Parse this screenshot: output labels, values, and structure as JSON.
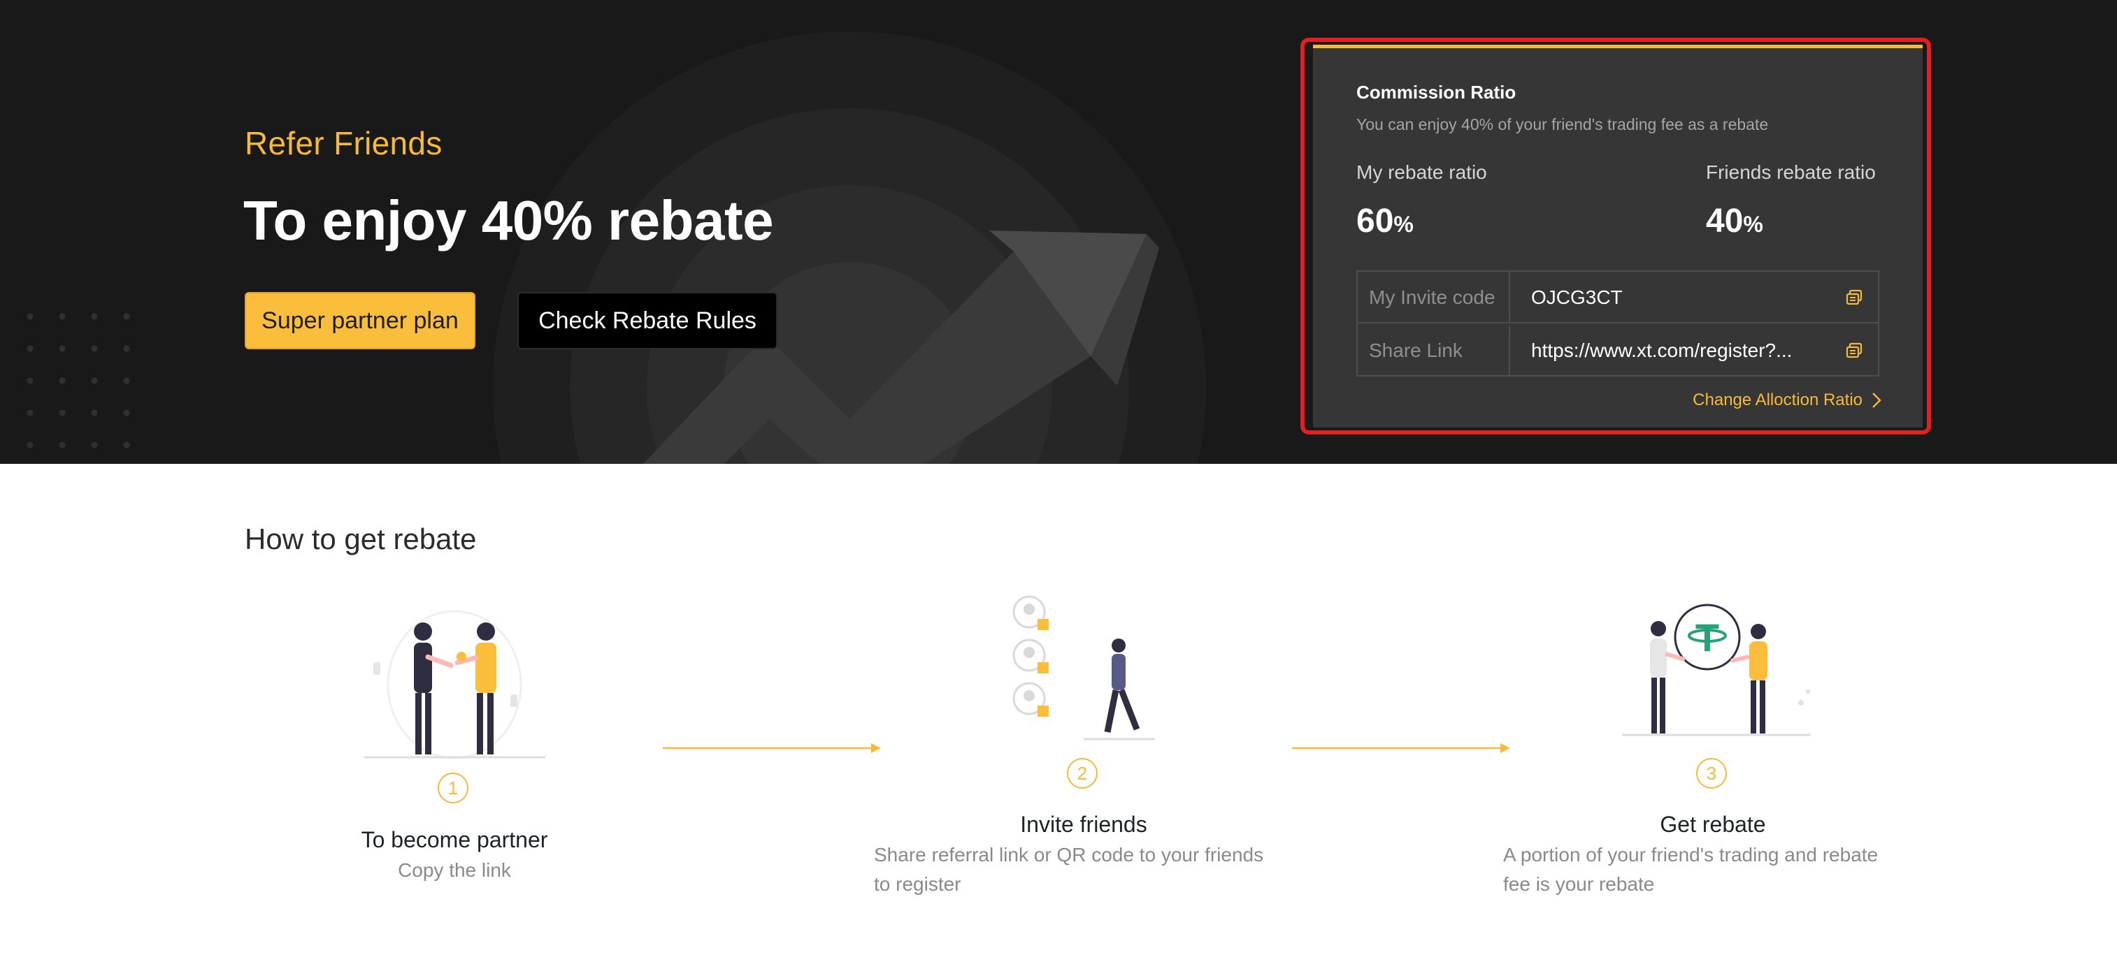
{
  "hero": {
    "refer_title": "Refer Friends",
    "headline": "To enjoy 40% rebate",
    "partner_button": "Super partner plan",
    "rules_button": "Check Rebate Rules"
  },
  "commission": {
    "title": "Commission Ratio",
    "subtitle": "You can enjoy 40% of your friend's trading fee as a rebate",
    "my_ratio_label": "My rebate ratio",
    "my_ratio_value": "60",
    "friends_ratio_label": "Friends rebate ratio",
    "friends_ratio_value": "40",
    "percent_sign": "%",
    "invite_code_label": "My Invite code",
    "invite_code_value": "OJCG3CT",
    "share_link_label": "Share Link",
    "share_link_value": "https://www.xt.com/register?...",
    "change_link": "Change Alloction Ratio"
  },
  "how_to": {
    "title": "How to get rebate",
    "steps": [
      {
        "number": "1",
        "title": "To become partner",
        "desc": "Copy the link"
      },
      {
        "number": "2",
        "title": "Invite friends",
        "desc_line1": "Share referral link or QR code to your friends",
        "desc_line2": "to register"
      },
      {
        "number": "3",
        "title": "Get rebate",
        "desc_line1": "A portion of your friend's trading and rebate",
        "desc_line2": "fee is your rebate"
      }
    ]
  },
  "colors": {
    "accent": "#f6b93b",
    "hero_bg": "#191919",
    "card_bg": "#363636",
    "highlight_border": "#e3201f"
  },
  "icons": [
    "copy-icon",
    "chevron-right-icon",
    "handshake-illustration",
    "invite-illustration",
    "tether-illustration",
    "arrow-right-icon"
  ]
}
